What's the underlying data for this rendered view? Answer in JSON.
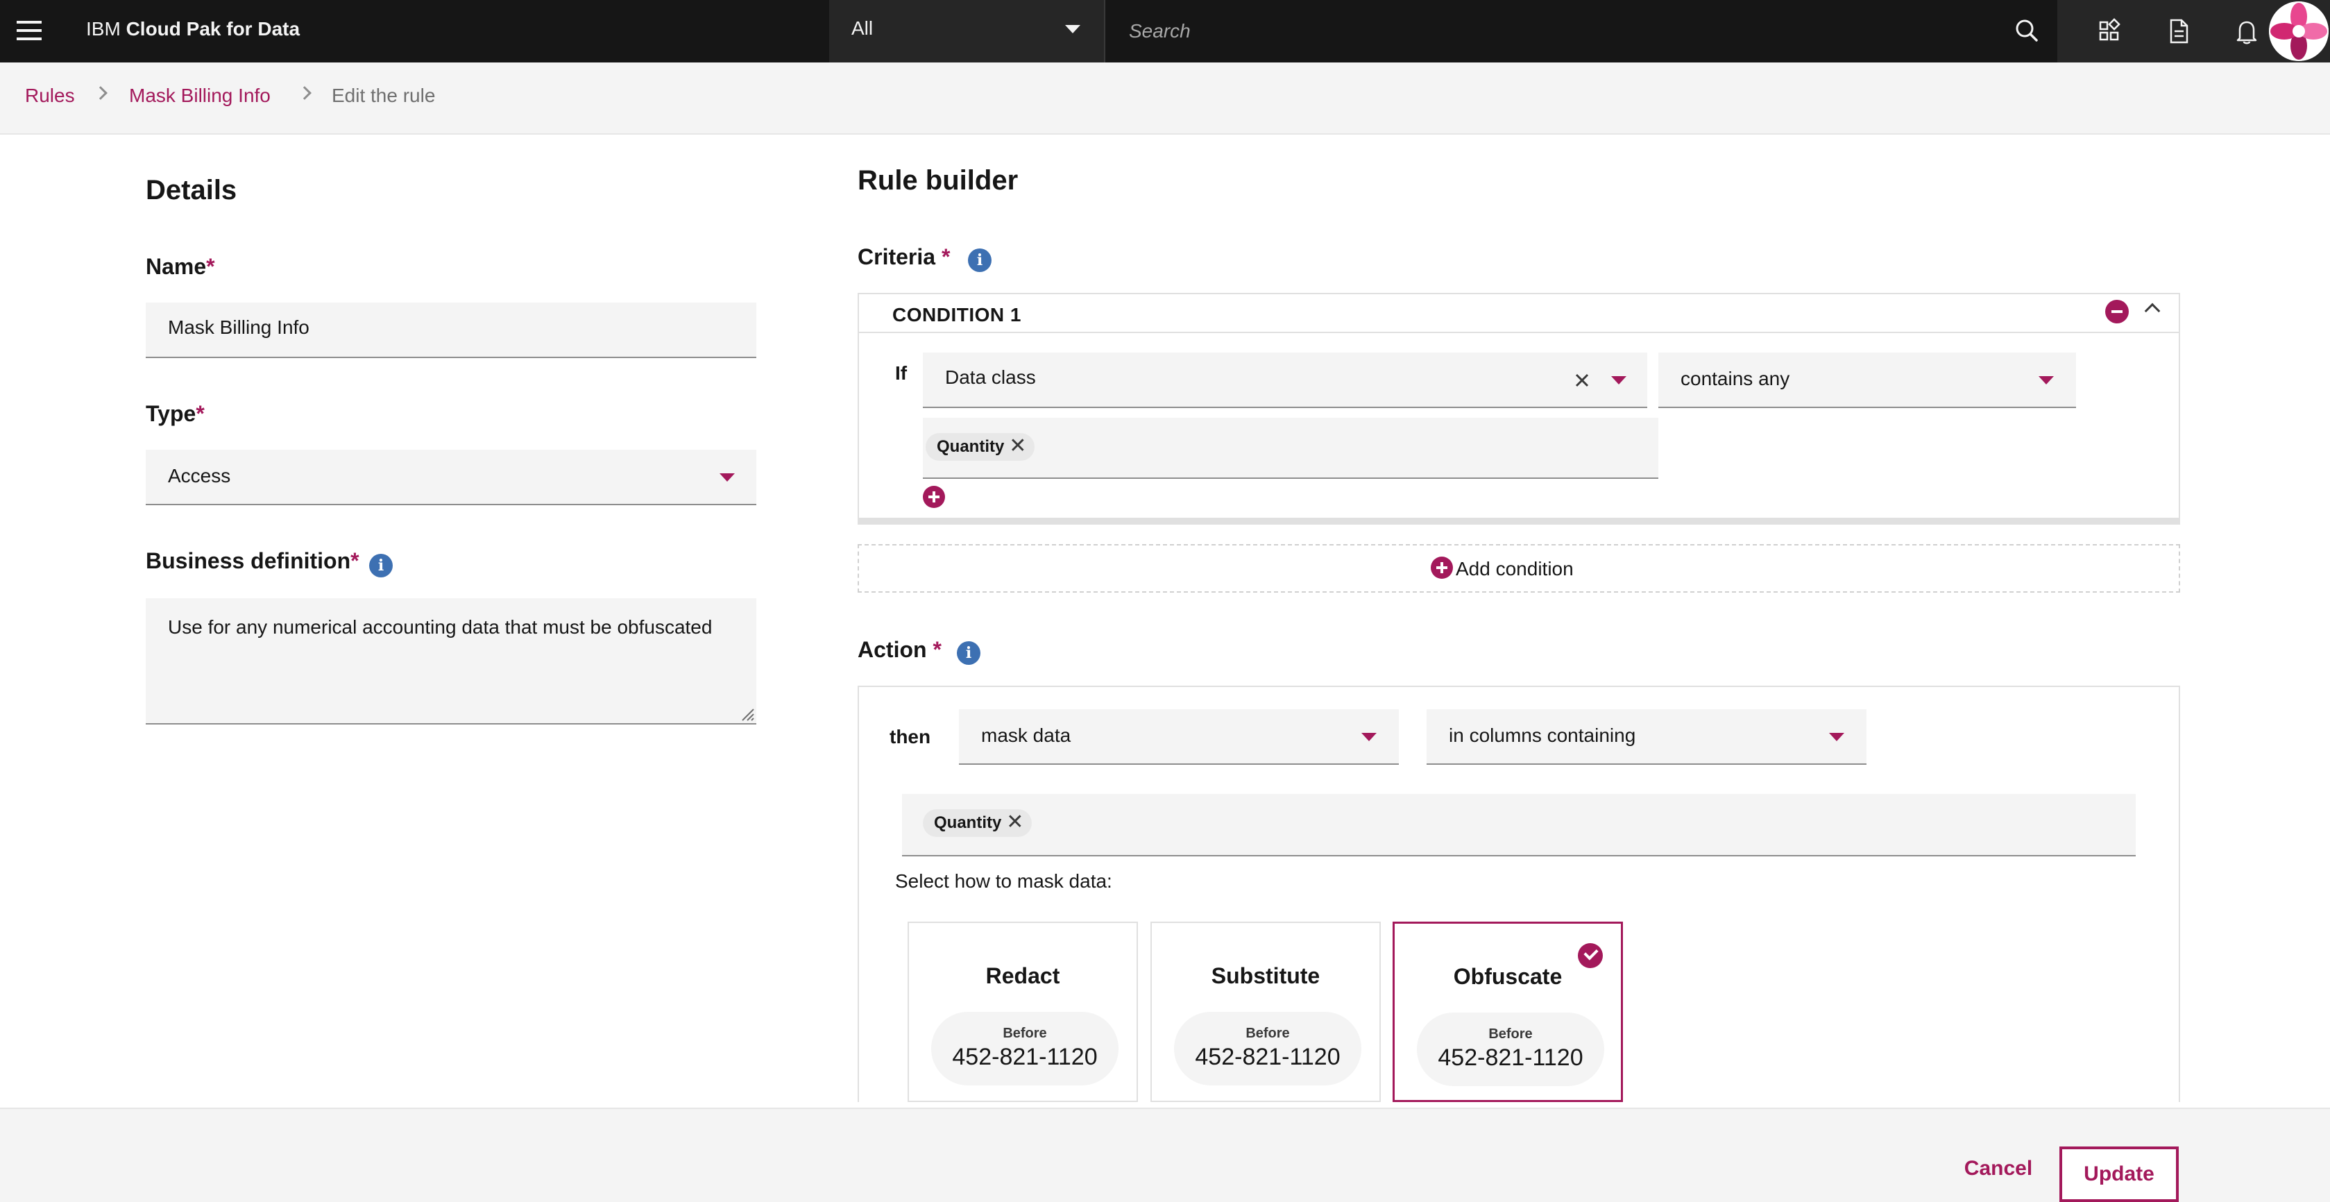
{
  "header": {
    "brand_prefix": "IBM",
    "brand_name": "Cloud Pak for Data",
    "scope_value": "All",
    "search_placeholder": "Search"
  },
  "breadcrumb": {
    "items": [
      "Rules",
      "Mask Billing Info"
    ],
    "current": "Edit the rule"
  },
  "details": {
    "heading": "Details",
    "name_label": "Name",
    "name_value": "Mask Billing Info",
    "type_label": "Type",
    "type_value": "Access",
    "business_label": "Business definition",
    "business_value": "Use for any numerical accounting data that must be obfuscated",
    "required_mark": "*"
  },
  "rule_builder": {
    "heading": "Rule builder",
    "criteria_label": "Criteria",
    "condition_title": "CONDITION 1",
    "if_label": "If",
    "property_value": "Data class",
    "operator_value": "contains any",
    "criteria_tag": "Quantity",
    "add_condition_label": "Add condition",
    "action_label": "Action",
    "then_label": "then",
    "action_value": "mask data",
    "scope_value": "in columns containing",
    "action_tag": "Quantity",
    "mask_prompt": "Select how to mask data:",
    "mask_options": [
      {
        "title": "Redact",
        "before_label": "Before",
        "example": "452-821-1120",
        "selected": false
      },
      {
        "title": "Substitute",
        "before_label": "Before",
        "example": "452-821-1120",
        "selected": false
      },
      {
        "title": "Obfuscate",
        "before_label": "Before",
        "example": "452-821-1120",
        "selected": true
      }
    ]
  },
  "footer": {
    "cancel_label": "Cancel",
    "update_label": "Update"
  },
  "colors": {
    "accent": "#a3195b",
    "topbar": "#161616",
    "info": "#3d70b2",
    "field_bg": "#f4f4f4"
  },
  "tag_remove_glyph": "✕"
}
